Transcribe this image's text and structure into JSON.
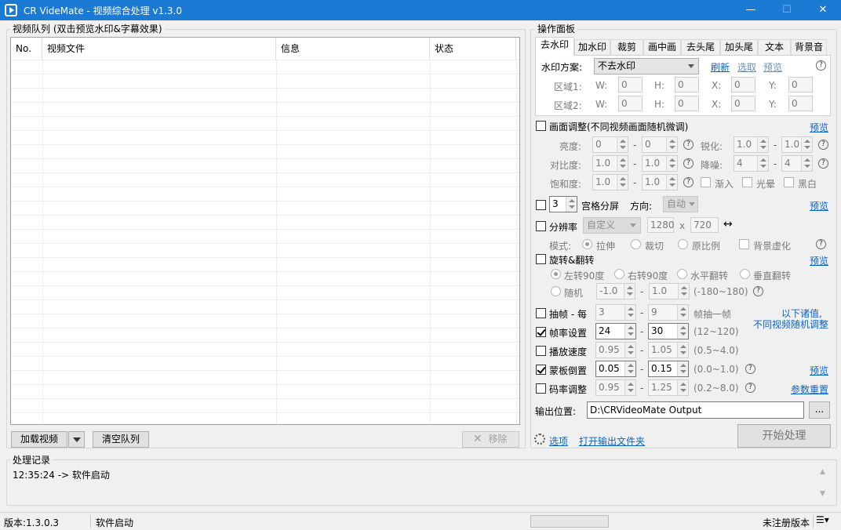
{
  "window": {
    "title": "CR VideMate - 视频综合处理 v1.3.0",
    "min": "—",
    "max": "☐",
    "close": "✕"
  },
  "queue": {
    "group_label": "视频队列 (双击预览水印&字幕效果)",
    "columns": [
      "No.",
      "视频文件",
      "信息",
      "状态"
    ],
    "add_button": "加载视频",
    "clear_button": "清空队列",
    "remove_button": "移除"
  },
  "panel": {
    "group_label": "操作面板",
    "tabs": [
      "去水印",
      "加水印",
      "裁剪",
      "画中画",
      "去头尾",
      "加头尾",
      "文本",
      "背景音"
    ],
    "watermark": {
      "label": "水印方案:",
      "scheme": "不去水印",
      "refresh": "刷新",
      "pick": "选取",
      "preview": "预览",
      "region1": "区域1:",
      "region2": "区域2:",
      "w": "W:",
      "h": "H:",
      "x": "X:",
      "y": "Y:",
      "zero": "0"
    }
  },
  "adjust": {
    "label": "画面调整(不同视频画面随机微调)",
    "preview": "预览",
    "brightness": "亮度:",
    "contrast": "对比度:",
    "saturation": "饱和度:",
    "sharpen": "锐化:",
    "denoise": "降噪:",
    "b1": "0",
    "b2": "0",
    "c1": "1.0",
    "c2": "1.0",
    "s1": "1.0",
    "s2": "1.0",
    "sh1": "1.0",
    "sh2": "1.0",
    "d1": "4",
    "d2": "4",
    "fadein": "渐入",
    "glare": "光晕",
    "bw": "黑白",
    "dash": "-",
    "qm": "?"
  },
  "grid": {
    "value": "3",
    "label": "宫格分屏",
    "direction": "方向:",
    "dir_value": "自动",
    "preview": "预览"
  },
  "resolution": {
    "label": "分辨率",
    "preset": "自定义",
    "width": "1280",
    "x": "x",
    "height": "720",
    "swap": "↔",
    "mode": "模式:",
    "stretch": "拉伸",
    "crop": "裁切",
    "ratio": "原比例",
    "blur": "背景虚化"
  },
  "rotate": {
    "label": "旋转&翻转",
    "preview": "预览",
    "left90": "左转90度",
    "right90": "右转90度",
    "hflip": "水平翻转",
    "vflip": "垂直翻转",
    "random": "随机",
    "r1": "-1.0",
    "r2": "1.0",
    "range": "(-180~180)"
  },
  "frames": {
    "extract_label": "抽帧 - 每",
    "e1": "3",
    "e2": "9",
    "e_suffix": "帧抽一帧",
    "note1": "以下诸值,",
    "note2": "不同视频随机调整",
    "fps_label": "帧率设置",
    "fps1": "24",
    "fps2": "30",
    "fps_range": "(12~120)",
    "speed_label": "播放速度",
    "sp1": "0.95",
    "sp2": "1.05",
    "sp_range": "(0.5~4.0)",
    "mask_label": "蒙板倒置",
    "m1": "0.05",
    "m2": "0.15",
    "m_range": "(0.0~1.0)",
    "m_preview": "预览",
    "bitrate_label": "码率调整",
    "br1": "0.95",
    "br2": "1.25",
    "br_range": "(0.2~8.0)",
    "reset": "参数重置"
  },
  "output": {
    "label": "输出位置:",
    "path": "D:\\CRVideoMate Output",
    "browse": "...",
    "options": "选项",
    "open_folder": "打开输出文件夹",
    "start": "开始处理"
  },
  "log": {
    "label": "处理记录",
    "line": "12:35:24 -> 软件启动"
  },
  "status": {
    "version": "版本:1.3.0.3",
    "message": "软件启动",
    "registration": "未注册版本"
  }
}
